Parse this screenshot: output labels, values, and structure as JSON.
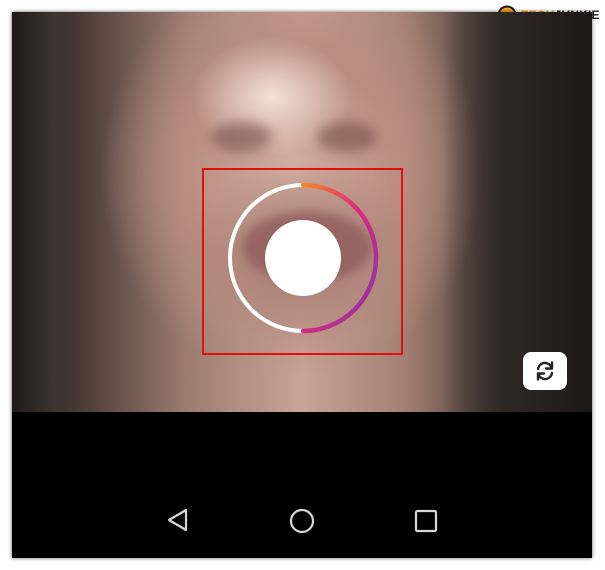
{
  "watermark": {
    "logo_icon": "techjunkie-logo-icon",
    "prefix": "TECH",
    "suffix": "JUNKIE",
    "accent_color": "#f5a623"
  },
  "camera": {
    "background": "face-close-up-with-textured-glass-effect",
    "record_button": {
      "icon": "record-button-icon",
      "ring_colors": [
        "#ffffff",
        "#f58529",
        "#dd2a7b",
        "#8134af"
      ],
      "center_color": "#ffffff"
    },
    "highlight_box_color": "#e01010",
    "flip_camera_icon": "flip-camera-icon"
  },
  "navigation": {
    "back_icon": "back-triangle-icon",
    "home_icon": "home-circle-icon",
    "recents_icon": "recents-square-icon"
  }
}
